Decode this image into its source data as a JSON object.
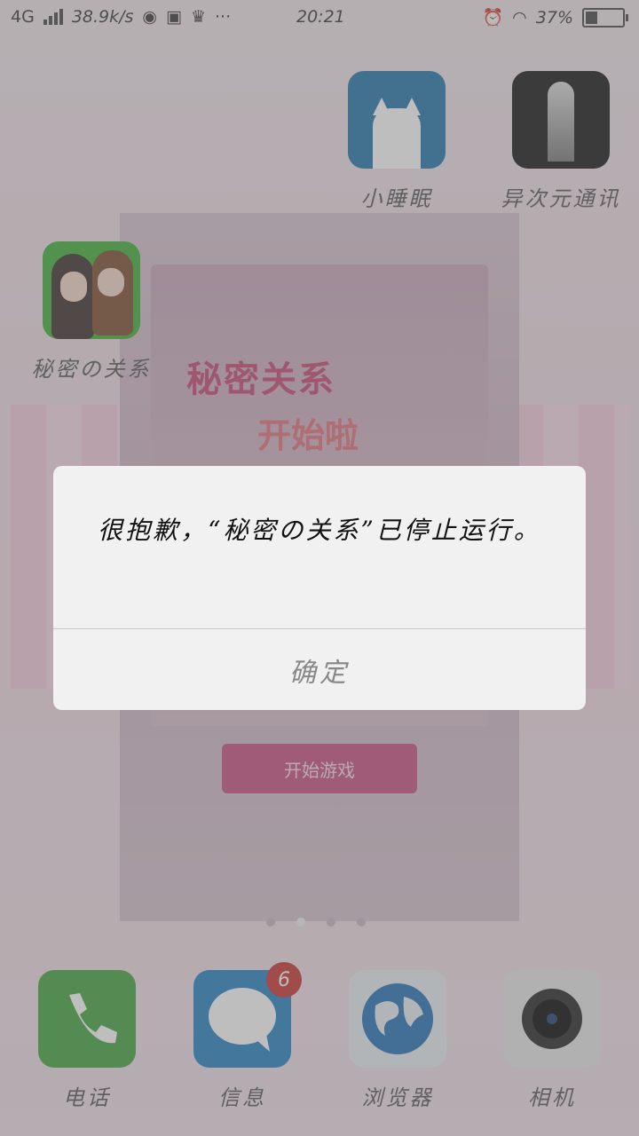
{
  "status_bar": {
    "network": "4G",
    "speed": "38.9k/s",
    "time": "20:21",
    "battery": "37%",
    "battery_level": 0.37
  },
  "home": {
    "apps": [
      {
        "label": "小睡眠",
        "icon": "cat-sleep-icon"
      },
      {
        "label": "异次元通讯",
        "icon": "dimension-door-icon"
      },
      {
        "label": "秘密の关系",
        "icon": "anime-couple-icon"
      }
    ],
    "dock": [
      {
        "label": "电话",
        "icon": "phone-icon"
      },
      {
        "label": "信息",
        "icon": "message-icon",
        "badge": "6"
      },
      {
        "label": "浏览器",
        "icon": "globe-icon"
      },
      {
        "label": "相机",
        "icon": "camera-icon"
      }
    ]
  },
  "wallpaper": {
    "title": "秘密关系",
    "subtitle": "开始啦",
    "start_button": "开始游戏"
  },
  "dialog": {
    "message": "很抱歉，“秘密の关系”已停止运行。",
    "ok_label": "确定"
  }
}
